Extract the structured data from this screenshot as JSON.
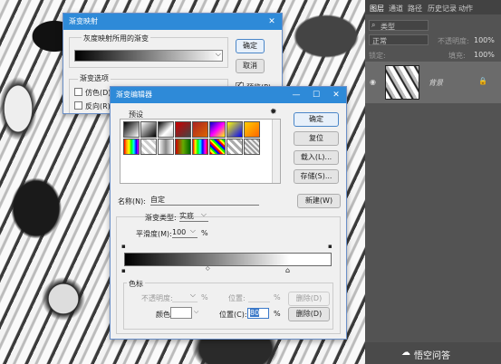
{
  "layers_panel": {
    "tabs": [
      "图层",
      "通道",
      "路径",
      "历史记录",
      "动作"
    ],
    "filter_label": "类型",
    "blend_mode": "正常",
    "opacity_label": "不透明度:",
    "opacity_value": "100%",
    "lock_label": "锁定:",
    "fill_label": "填充:",
    "fill_value": "100%",
    "layer_name": "背景",
    "watermark": "悟空问答"
  },
  "gradient_map_dialog": {
    "title": "渐变映射",
    "group_label": "灰度映射所用的渐变",
    "options_label": "渐变选项",
    "dither_label": "仿色(D)",
    "reverse_label": "反向(R)",
    "ok_label": "确定",
    "cancel_label": "取消",
    "preview_label": "预览(P)"
  },
  "gradient_editor": {
    "title": "渐变编辑器",
    "presets_label": "预设",
    "ok_label": "确定",
    "reset_label": "复位",
    "load_label": "载入(L)...",
    "save_label": "存储(S)...",
    "name_label": "名称(N):",
    "name_value": "自定",
    "new_label": "新建(W)",
    "gradient_type_label": "渐变类型:",
    "gradient_type_value": "实底",
    "smoothness_label": "平滑度(M):",
    "smoothness_value": "100",
    "smoothness_unit": "%",
    "stops_label": "色标",
    "stop_opacity_label": "不透明度:",
    "stop_opacity_unit": "%",
    "opacity_location_label": "位置:",
    "opacity_location_unit": "%",
    "opacity_delete_label": "删除(D)",
    "color_label": "颜色:",
    "color_location_label": "位置(C):",
    "color_location_value": "80",
    "color_location_unit": "%",
    "color_delete_label": "删除(D)"
  },
  "colors": {
    "titlebar": "#2e8ad8",
    "panel_bg": "#535353"
  }
}
